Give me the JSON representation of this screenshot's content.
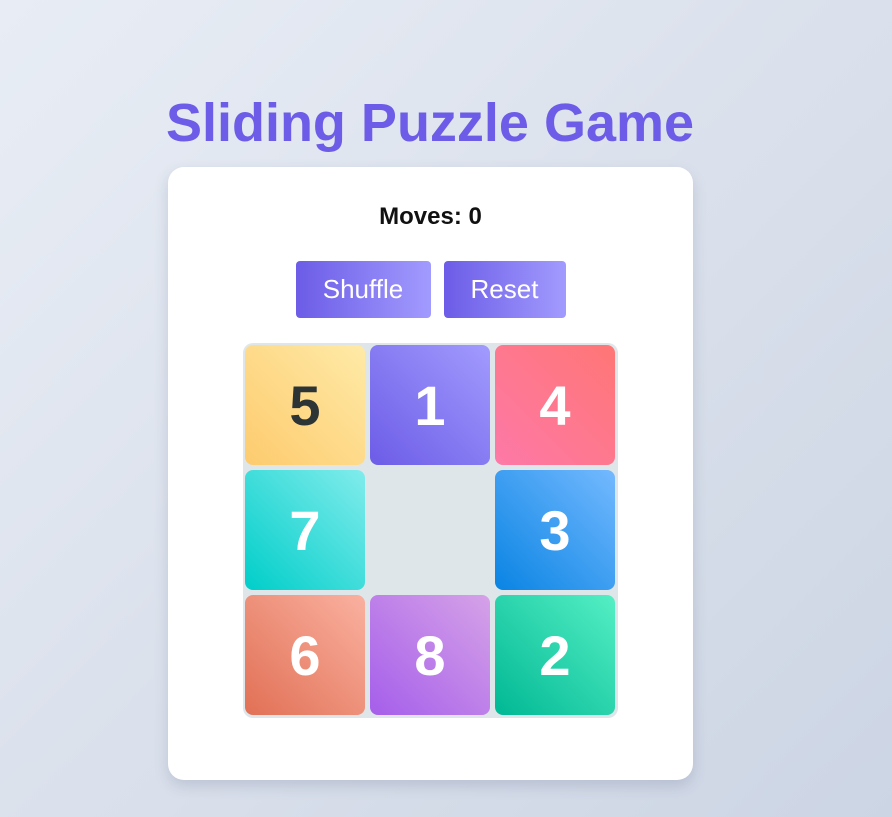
{
  "title": "Sliding Puzzle Game",
  "moves_label": "Moves: 0",
  "moves": 0,
  "buttons": {
    "shuffle": "Shuffle",
    "reset": "Reset"
  },
  "board": {
    "size": 3,
    "tiles": [
      {
        "value": "5",
        "colors": [
          "#fdcb6e",
          "#ffeaa7"
        ],
        "text_color": "#2d3436"
      },
      {
        "value": "1",
        "colors": [
          "#6c5ce7",
          "#a29bfe"
        ],
        "text_color": "#ffffff"
      },
      {
        "value": "4",
        "colors": [
          "#fd79a8",
          "#ff7675"
        ],
        "text_color": "#ffffff"
      },
      {
        "value": "7",
        "colors": [
          "#00cec9",
          "#81ecec"
        ],
        "text_color": "#ffffff"
      },
      {
        "value": "",
        "colors": null,
        "text_color": null
      },
      {
        "value": "3",
        "colors": [
          "#0984e3",
          "#74b9ff"
        ],
        "text_color": "#ffffff"
      },
      {
        "value": "6",
        "colors": [
          "#e17055",
          "#fab1a0"
        ],
        "text_color": "#ffffff"
      },
      {
        "value": "8",
        "colors": [
          "#a55eea",
          "#d6a2e8"
        ],
        "text_color": "#ffffff"
      },
      {
        "value": "2",
        "colors": [
          "#00b894",
          "#55efc4"
        ],
        "text_color": "#ffffff"
      }
    ]
  },
  "colors": {
    "accent": "#6c5ce7",
    "board_bg": "#dfe6e9"
  }
}
